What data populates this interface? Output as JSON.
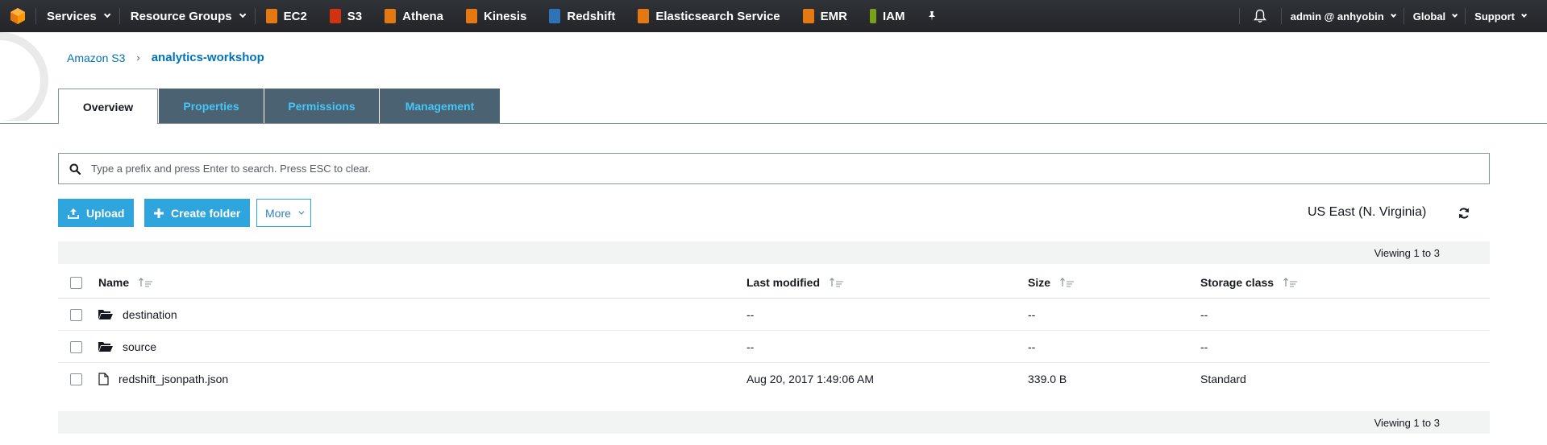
{
  "topnav": {
    "services": "Services",
    "resource_groups": "Resource Groups",
    "shortcuts": [
      {
        "label": "EC2",
        "icon": "ec2-icon",
        "color": "#e47911"
      },
      {
        "label": "S3",
        "icon": "s3-icon",
        "color": "#d13212"
      },
      {
        "label": "Athena",
        "icon": "athena-icon",
        "color": "#e47911"
      },
      {
        "label": "Kinesis",
        "icon": "kinesis-icon",
        "color": "#e47911"
      },
      {
        "label": "Redshift",
        "icon": "redshift-icon",
        "color": "#2e73b8"
      },
      {
        "label": "Elasticsearch Service",
        "icon": "elasticsearch-icon",
        "color": "#e47911"
      },
      {
        "label": "EMR",
        "icon": "emr-icon",
        "color": "#e47911"
      },
      {
        "label": "IAM",
        "icon": "iam-icon",
        "color": "#7aa116"
      }
    ],
    "account": "admin @ anhyobin",
    "region": "Global",
    "support": "Support"
  },
  "breadcrumb": {
    "root": "Amazon S3",
    "current": "analytics-workshop"
  },
  "tabs": [
    "Overview",
    "Properties",
    "Permissions",
    "Management"
  ],
  "search": {
    "placeholder": "Type a prefix and press Enter to search. Press ESC to clear."
  },
  "actions": {
    "upload": "Upload",
    "create_folder": "Create folder",
    "more": "More"
  },
  "region_label": "US East (N. Virginia)",
  "viewing": "Viewing 1 to 3",
  "table": {
    "columns": [
      "Name",
      "Last modified",
      "Size",
      "Storage class"
    ],
    "rows": [
      {
        "type": "folder",
        "name": "destination",
        "modified": "--",
        "size": "--",
        "class": "--"
      },
      {
        "type": "folder",
        "name": "source",
        "modified": "--",
        "size": "--",
        "class": "--"
      },
      {
        "type": "file",
        "name": "redshift_jsonpath.json",
        "modified": "Aug 20, 2017 1:49:06 AM",
        "size": "339.0 B",
        "class": "Standard"
      }
    ]
  },
  "colors": {
    "accent": "#2ea6dd",
    "link": "#0073bb",
    "nav_bg": "#232f3e",
    "tab_inactive_bg": "#4b6273",
    "tab_inactive_text": "#44c6f7"
  }
}
